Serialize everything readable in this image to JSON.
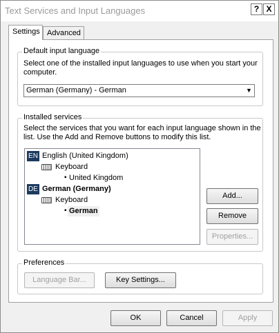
{
  "window": {
    "title": "Text Services and Input Languages",
    "help_label": "?",
    "close_label": "X"
  },
  "tabs": [
    {
      "label": "Settings",
      "selected": true
    },
    {
      "label": "Advanced",
      "selected": false
    }
  ],
  "default_input": {
    "group_label": "Default input language",
    "description_line1": "Select one of the installed input languages to use when you start your",
    "description_line2": "computer.",
    "selected_value": "German (Germany) - German"
  },
  "installed_services": {
    "group_label": "Installed services",
    "description_line1": "Select the services that you want for each input language shown in the",
    "description_line2": "list. Use the Add and Remove buttons to modify this list.",
    "tree": {
      "en": {
        "badge": "EN",
        "language": "English (United Kingdom)",
        "category": "Keyboard",
        "layout": "United Kingdom"
      },
      "de": {
        "badge": "DE",
        "language": "German (Germany)",
        "category": "Keyboard",
        "layout": "German"
      }
    },
    "buttons": {
      "add": "Add...",
      "remove": "Remove",
      "properties": "Properties..."
    }
  },
  "preferences": {
    "group_label": "Preferences",
    "language_bar": "Language Bar...",
    "key_settings": "Key Settings..."
  },
  "footer": {
    "ok": "OK",
    "cancel": "Cancel",
    "apply": "Apply"
  },
  "colors": {
    "lang_badge": "#1c3a5e",
    "disabled_text": "#a0a0a0"
  }
}
